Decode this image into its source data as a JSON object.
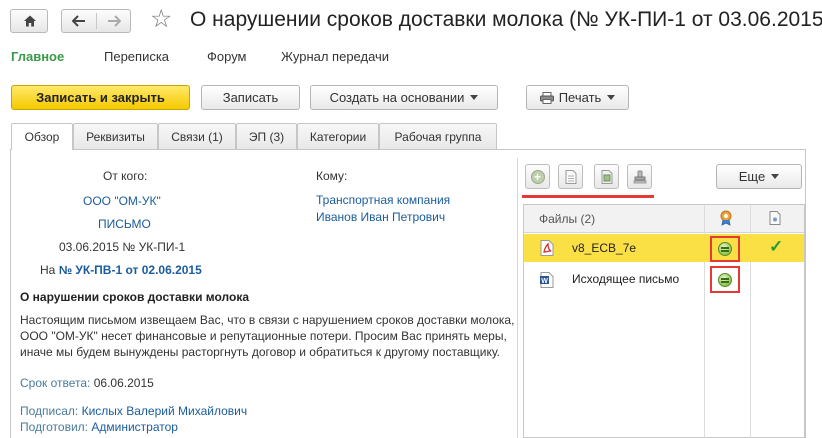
{
  "header": {
    "title": "О нарушении сроков доставки молока (№ УК-ПИ-1 от 03.06.2015"
  },
  "menu": [
    {
      "label": "Главное"
    },
    {
      "label": "Переписка"
    },
    {
      "label": "Форум"
    },
    {
      "label": "Журнал передачи"
    }
  ],
  "toolbar": {
    "save_close": "Записать и закрыть",
    "save": "Записать",
    "create_based": "Создать на основании",
    "print": "Печать"
  },
  "tabs": [
    {
      "label": "Обзор"
    },
    {
      "label": "Реквизиты"
    },
    {
      "label": "Связи (1)"
    },
    {
      "label": "ЭП (3)"
    },
    {
      "label": "Категории"
    },
    {
      "label": "Рабочая группа"
    }
  ],
  "doc": {
    "from_label": "От кого:",
    "from_org": "ООО \"ОМ-УК\"",
    "doc_type": "ПИСЬМО",
    "reg_line": "03.06.2015 № УК-ПИ-1",
    "reply_prefix": "На",
    "reply_ref": "№ УК-ПВ-1 от 02.06.2015",
    "to_label": "Кому:",
    "to_org": "Транспортная компания",
    "to_person": "Иванов Иван Петрович",
    "subject": "О нарушении сроков доставки молока",
    "body": "Настоящим письмом извещаем Вас, что в связи с нарушением сроков доставки молока, ООО \"ОМ-УК\" несет финансовые и репутационные потери. Просим Вас принять меры, иначе мы будем вынуждены расторгнуть договор и обратиться к другому поставщику.",
    "deadline_label": "Срок ответа:",
    "deadline_value": "06.06.2015",
    "signed_label": "Подписал:",
    "signed_value": "Кислых Валерий Михайлович",
    "prepared_label": "Подготовил:",
    "prepared_value": "Администратор"
  },
  "files": {
    "more_label": "Еще",
    "header": "Файлы (2)",
    "rows": [
      {
        "name": "v8_ECB_7e",
        "icon": "pdf-icon",
        "signed": true,
        "checked": true
      },
      {
        "name": "Исходящее письмо",
        "icon": "word-icon",
        "signed": true,
        "checked": false
      }
    ]
  },
  "colors": {
    "accent_green": "#3a9a4a",
    "primary_button": "#f5c900",
    "link": "#1a5c9e",
    "selected_row": "#fbe045",
    "highlight_red": "#e53935"
  }
}
